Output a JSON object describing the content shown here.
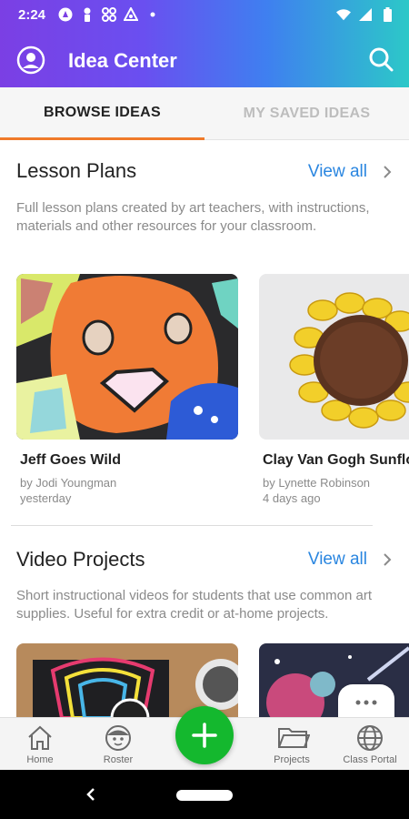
{
  "status_bar": {
    "time": "2:24"
  },
  "app_bar": {
    "title": "Idea Center"
  },
  "tabs": [
    {
      "label": "BROWSE IDEAS",
      "active": true
    },
    {
      "label": "MY SAVED IDEAS",
      "active": false
    }
  ],
  "lesson_plans": {
    "title": "Lesson Plans",
    "view_all": "View all",
    "description": "Full lesson plans created by art teachers, with instructions, materials and other resources for your classroom.",
    "cards": [
      {
        "title": "Jeff Goes Wild",
        "author": "by Jodi Youngman",
        "date": "yesterday"
      },
      {
        "title": "Clay Van Gogh Sunflo",
        "author": "by Lynette Robinson",
        "date": "4 days ago"
      }
    ]
  },
  "video_projects": {
    "title": "Video Projects",
    "view_all": "View all",
    "description": "Short instructional videos for students that use common art supplies. Useful for extra credit or at-home projects."
  },
  "bottom_nav": {
    "items": [
      {
        "label": "Home",
        "icon": "home-icon"
      },
      {
        "label": "Roster",
        "icon": "roster-icon"
      },
      {
        "label": "Projects",
        "icon": "folder-icon"
      },
      {
        "label": "Class Portal",
        "icon": "globe-icon"
      }
    ]
  },
  "colors": {
    "accent_orange": "#f07a2a",
    "link_blue": "#2a86e0",
    "fab_green": "#14b82e"
  }
}
